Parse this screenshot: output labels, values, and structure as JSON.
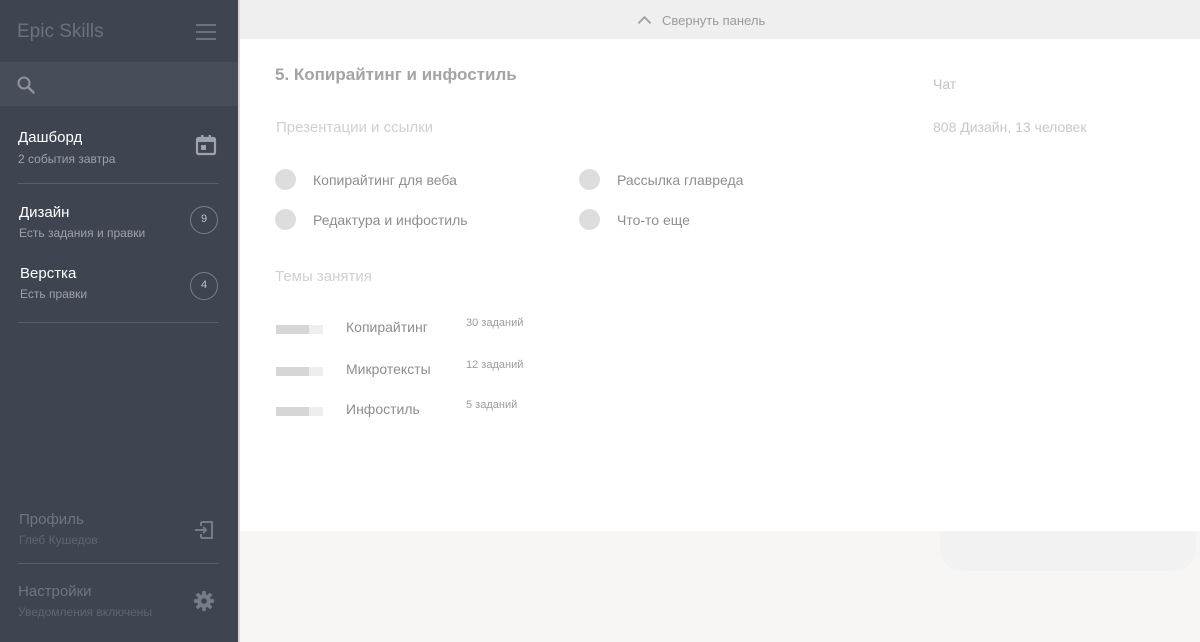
{
  "sidebar": {
    "brand": "Epic Skills",
    "search": {
      "placeholder": ""
    },
    "items": [
      {
        "title": "Дашборд",
        "subtitle": "2 события завтра",
        "icon": "calendar-icon"
      },
      {
        "title": "Дизайн",
        "subtitle": "Есть задания и правки",
        "badge": "9"
      },
      {
        "title": "Верстка",
        "subtitle": "Есть правки",
        "badge": "4"
      }
    ],
    "bottom": [
      {
        "title": "Профиль",
        "subtitle": "Глеб Кушедов",
        "icon": "logout-icon"
      },
      {
        "title": "Настройки",
        "subtitle": "Уведомления включены",
        "icon": "gear-icon"
      }
    ]
  },
  "topbar": {
    "collapse_label": "Свернуть панель",
    "icon": "chevron-up-icon"
  },
  "main": {
    "title": "5. Копирайтинг и инфостиль",
    "links_heading": "Презентации и ссылки",
    "links": [
      "Копирайтинг для веба",
      "Рассылка главреда",
      "Редактура и инфостиль",
      "Что-то еще"
    ],
    "topics_heading": "Темы занятия",
    "topics": [
      {
        "name": "Копирайтинг",
        "count": "30 заданий",
        "progress": 0.7
      },
      {
        "name": "Микротексты",
        "count": "12 заданий",
        "progress": 0.7
      },
      {
        "name": "Инфостиль",
        "count": "5 заданий",
        "progress": 0.7
      }
    ]
  },
  "chat": {
    "label": "Чат",
    "info": "808 Дизайн, 13 человек"
  },
  "colors": {
    "sidebar_bg": "#3e4450",
    "search_bg": "#474d59",
    "content_bg": "#ffffff",
    "page_bg": "#f7f6f4"
  }
}
